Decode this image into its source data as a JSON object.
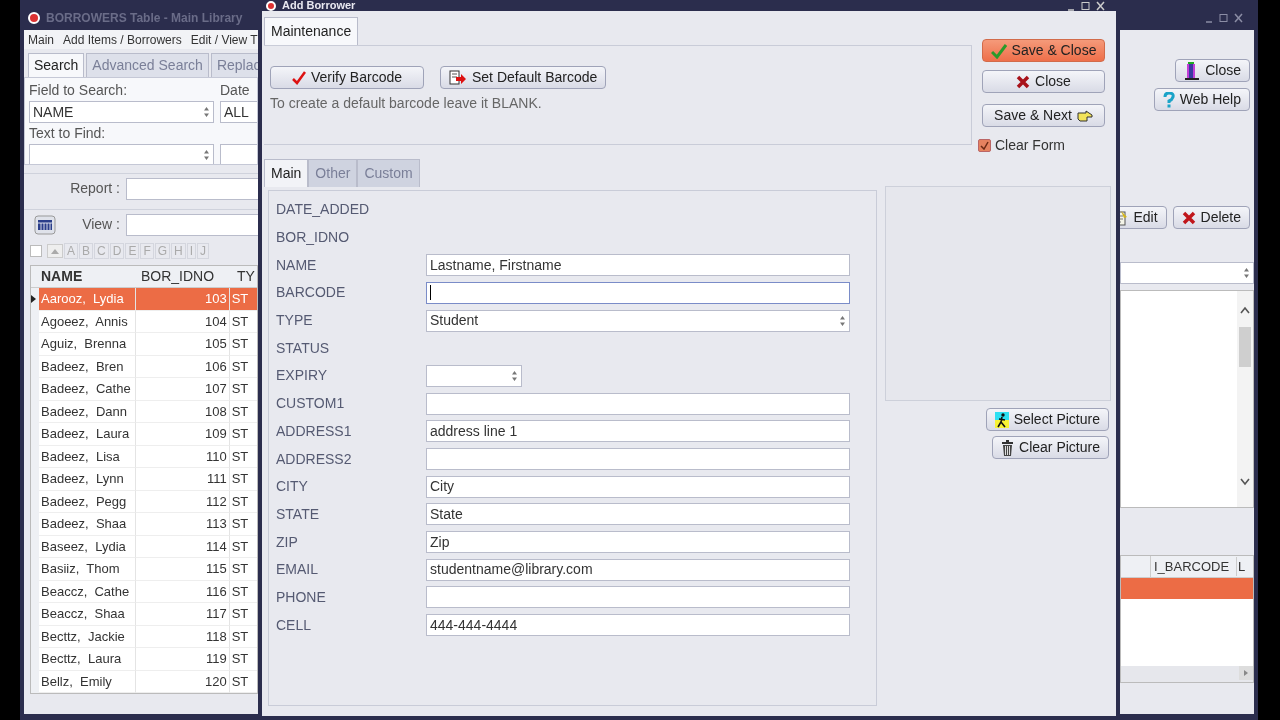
{
  "back_window": {
    "title": "BORROWERS Table - Main Library",
    "menu": [
      "Main",
      "Add Items / Borrowers",
      "Edit / View T"
    ],
    "tabs": [
      {
        "label": "Search",
        "selected": true
      },
      {
        "label": "Advanced Search",
        "selected": false
      },
      {
        "label": "Replac",
        "selected": false
      }
    ],
    "field_to_search": {
      "label": "Field to Search:",
      "value": "NAME"
    },
    "date": {
      "label": "Date",
      "value": "ALL"
    },
    "text_to_find": {
      "label": "Text to Find:"
    },
    "report": {
      "label": "Report :"
    },
    "view": {
      "label": "View :"
    },
    "select_all": {
      "checked": false
    },
    "letters": [
      "A",
      "B",
      "C",
      "D",
      "E",
      "F",
      "G",
      "H",
      "I",
      "J"
    ],
    "table": {
      "columns": [
        "NAME",
        "BOR_IDNO",
        "TY"
      ],
      "rows": [
        {
          "name": "Aarooz,  Lydia",
          "id": "103",
          "type": "ST",
          "selected": true
        },
        {
          "name": "Agoeez,  Annis",
          "id": "104",
          "type": "ST",
          "selected": false
        },
        {
          "name": "Aguiz,  Brenna",
          "id": "105",
          "type": "ST",
          "selected": false
        },
        {
          "name": "Badeez,  Bren",
          "id": "106",
          "type": "ST",
          "selected": false
        },
        {
          "name": "Badeez,  Cathe",
          "id": "107",
          "type": "ST",
          "selected": false
        },
        {
          "name": "Badeez,  Dann",
          "id": "108",
          "type": "ST",
          "selected": false
        },
        {
          "name": "Badeez,  Laura",
          "id": "109",
          "type": "ST",
          "selected": false
        },
        {
          "name": "Badeez,  Lisa",
          "id": "110",
          "type": "ST",
          "selected": false
        },
        {
          "name": "Badeez,  Lynn",
          "id": "111",
          "type": "ST",
          "selected": false
        },
        {
          "name": "Badeez,  Pegg",
          "id": "112",
          "type": "ST",
          "selected": false
        },
        {
          "name": "Badeez,  Shaa",
          "id": "113",
          "type": "ST",
          "selected": false
        },
        {
          "name": "Baseez,  Lydia",
          "id": "114",
          "type": "ST",
          "selected": false
        },
        {
          "name": "Basiiz,  Thom",
          "id": "115",
          "type": "ST",
          "selected": false
        },
        {
          "name": "Beaccz,  Cathe",
          "id": "116",
          "type": "ST",
          "selected": false
        },
        {
          "name": "Beaccz,  Shaa",
          "id": "117",
          "type": "ST",
          "selected": false
        },
        {
          "name": "Becttz,  Jackie",
          "id": "118",
          "type": "ST",
          "selected": false
        },
        {
          "name": "Becttz,  Laura",
          "id": "119",
          "type": "ST",
          "selected": false
        },
        {
          "name": "Bellz,  Emily",
          "id": "120",
          "type": "ST",
          "selected": false
        }
      ]
    },
    "buttons": [
      {
        "label": "Close"
      },
      {
        "label": "Web Help"
      }
    ],
    "row_buttons": [
      {
        "label": "Edit"
      },
      {
        "label": "Delete"
      }
    ],
    "lower_grid": {
      "columns": [
        "I_BARCODE",
        "L"
      ],
      "rows": [
        {
          "selected": true
        }
      ]
    }
  },
  "dialog": {
    "title": "Add Borrower",
    "maintenance_tab": {
      "label": "Maintenance",
      "selected": true
    },
    "barcode_buttons": [
      {
        "label": "Verify Barcode"
      },
      {
        "label": "Set Default Barcode"
      }
    ],
    "hint": "To create a default barcode leave it BLANK.",
    "action_buttons": [
      {
        "label": "Save & Close",
        "default": true
      },
      {
        "label": "Close",
        "default": false
      },
      {
        "label": "Save & Next",
        "default": false
      }
    ],
    "clear_form": {
      "label": "Clear Form",
      "checked": true
    },
    "tabs": [
      {
        "label": "Main",
        "selected": true
      },
      {
        "label": "Other",
        "selected": false
      },
      {
        "label": "Custom",
        "selected": false
      }
    ],
    "fields": [
      {
        "label": "DATE_ADDED",
        "kind": "none"
      },
      {
        "label": "BOR_IDNO",
        "kind": "none"
      },
      {
        "label": "NAME",
        "kind": "text",
        "value": "Lastname, Firstname"
      },
      {
        "label": "BARCODE",
        "kind": "text",
        "focused": true
      },
      {
        "label": "TYPE",
        "kind": "select",
        "value": "Student"
      },
      {
        "label": "STATUS",
        "kind": "none"
      },
      {
        "label": "EXPIRY",
        "kind": "date"
      },
      {
        "label": "CUSTOM1",
        "kind": "text"
      },
      {
        "label": "ADDRESS1",
        "kind": "text",
        "value": "address line 1"
      },
      {
        "label": "ADDRESS2",
        "kind": "text"
      },
      {
        "label": "CITY",
        "kind": "text",
        "value": "City"
      },
      {
        "label": "STATE",
        "kind": "text",
        "value": "State"
      },
      {
        "label": "ZIP",
        "kind": "text",
        "value": "Zip"
      },
      {
        "label": "EMAIL",
        "kind": "text",
        "value": "studentname@library.com"
      },
      {
        "label": "PHONE",
        "kind": "text"
      },
      {
        "label": "CELL",
        "kind": "text",
        "value": "444-444-4444"
      }
    ],
    "picture_buttons": [
      {
        "label": "Select Picture"
      },
      {
        "label": "Clear Picture"
      }
    ]
  }
}
